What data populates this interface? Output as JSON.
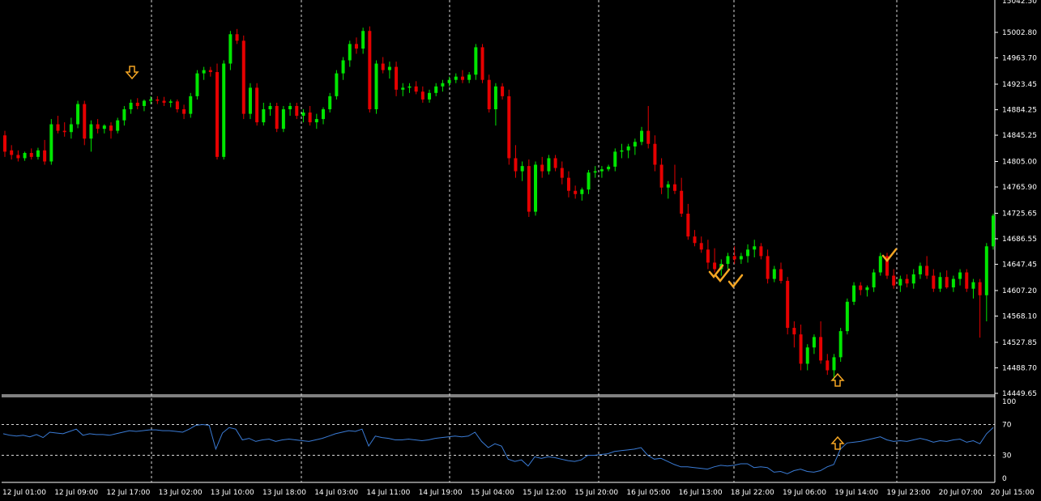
{
  "colors": {
    "background": "#000000",
    "bull": "#00e600",
    "bear": "#e60000",
    "grid": "#d8d8d8",
    "axis_text": "#ffffff",
    "indicator_line": "#3a7bd5",
    "marker": "#f5a623"
  },
  "price_axis": {
    "labels": [
      "15002.80",
      "14963.70",
      "14923.45",
      "14884.25",
      "14845.25",
      "14805.00",
      "14765.90",
      "14725.65",
      "14686.55",
      "14647.45",
      "14607.20",
      "14568.10",
      "14527.85",
      "14488.70",
      "14449.65"
    ],
    "top_label": "15042.50"
  },
  "indicator_axis": {
    "labels": [
      "100",
      "70",
      "30",
      "0"
    ]
  },
  "time_axis": {
    "labels": [
      "12 Jul 01:00",
      "12 Jul 09:00",
      "12 Jul 17:00",
      "13 Jul 02:00",
      "13 Jul 10:00",
      "13 Jul 18:00",
      "14 Jul 03:00",
      "14 Jul 11:00",
      "14 Jul 19:00",
      "15 Jul 04:00",
      "15 Jul 12:00",
      "15 Jul 20:00",
      "16 Jul 05:00",
      "16 Jul 13:00",
      "18 Jul 22:00",
      "19 Jul 06:00",
      "19 Jul 14:00",
      "19 Jul 23:00",
      "20 Jul 07:00",
      "20 Jul 15:00"
    ]
  },
  "markers": [
    {
      "type": "arrow-down",
      "near": "12 Jul 17:00"
    },
    {
      "type": "check",
      "near": "16 Jul 13:00"
    },
    {
      "type": "check",
      "near": "16 Jul 13:00"
    },
    {
      "type": "check",
      "near": "18 Jul 22:00"
    },
    {
      "type": "arrow-up",
      "near": "19 Jul 14:00"
    },
    {
      "type": "check",
      "near": "19 Jul 23:00"
    },
    {
      "type": "arrow-up-indicator",
      "near": "19 Jul 14:00"
    }
  ],
  "chart_data": {
    "type": "candlestick",
    "y_range": [
      14449.65,
      15042.5
    ],
    "indicator_range": [
      0,
      100
    ],
    "indicator_levels": [
      70,
      30
    ],
    "candles": [
      [
        14845,
        14852,
        14812,
        14820
      ],
      [
        14822,
        14830,
        14808,
        14815
      ],
      [
        14815,
        14822,
        14805,
        14810
      ],
      [
        14810,
        14820,
        14806,
        14818
      ],
      [
        14818,
        14825,
        14808,
        14812
      ],
      [
        14812,
        14826,
        14808,
        14822
      ],
      [
        14822,
        14838,
        14800,
        14805
      ],
      [
        14805,
        14870,
        14800,
        14862
      ],
      [
        14862,
        14875,
        14848,
        14852
      ],
      [
        14852,
        14865,
        14843,
        14850
      ],
      [
        14850,
        14872,
        14840,
        14862
      ],
      [
        14862,
        14898,
        14856,
        14893
      ],
      [
        14893,
        14898,
        14830,
        14840
      ],
      [
        14840,
        14868,
        14820,
        14862
      ],
      [
        14862,
        14870,
        14848,
        14855
      ],
      [
        14855,
        14862,
        14848,
        14860
      ],
      [
        14860,
        14865,
        14840,
        14852
      ],
      [
        14852,
        14872,
        14848,
        14868
      ],
      [
        14868,
        14890,
        14860,
        14885
      ],
      [
        14885,
        14900,
        14878,
        14895
      ],
      [
        14895,
        14902,
        14885,
        14890
      ],
      [
        14890,
        14900,
        14882,
        14898
      ],
      [
        14898,
        14905,
        14893,
        14900
      ],
      [
        14900,
        14905,
        14893,
        14898
      ],
      [
        14898,
        14904,
        14890,
        14895
      ],
      [
        14895,
        14900,
        14888,
        14897
      ],
      [
        14897,
        14900,
        14880,
        14885
      ],
      [
        14885,
        14892,
        14870,
        14878
      ],
      [
        14878,
        14910,
        14872,
        14905
      ],
      [
        14905,
        14945,
        14900,
        14940
      ],
      [
        14940,
        14950,
        14930,
        14945
      ],
      [
        14945,
        14950,
        14935,
        14942
      ],
      [
        14942,
        14955,
        14808,
        14812
      ],
      [
        14812,
        14960,
        14808,
        14955
      ],
      [
        14955,
        15005,
        14945,
        15000
      ],
      [
        15000,
        15008,
        14985,
        14990
      ],
      [
        14990,
        14998,
        14870,
        14878
      ],
      [
        14878,
        14925,
        14870,
        14918
      ],
      [
        14918,
        14925,
        14860,
        14865
      ],
      [
        14865,
        14895,
        14860,
        14885
      ],
      [
        14885,
        14895,
        14875,
        14890
      ],
      [
        14890,
        14895,
        14850,
        14855
      ],
      [
        14855,
        14890,
        14850,
        14885
      ],
      [
        14885,
        14895,
        14875,
        14890
      ],
      [
        14890,
        14895,
        14870,
        14875
      ],
      [
        14875,
        14885,
        14865,
        14880
      ],
      [
        14880,
        14890,
        14860,
        14865
      ],
      [
        14865,
        14878,
        14855,
        14870
      ],
      [
        14870,
        14888,
        14862,
        14885
      ],
      [
        14885,
        14910,
        14880,
        14905
      ],
      [
        14905,
        14945,
        14900,
        14940
      ],
      [
        14940,
        14965,
        14930,
        14960
      ],
      [
        14960,
        14990,
        14950,
        14985
      ],
      [
        14985,
        14995,
        14970,
        14978
      ],
      [
        14978,
        15010,
        14970,
        15005
      ],
      [
        15005,
        15012,
        14880,
        14885
      ],
      [
        14885,
        14960,
        14878,
        14955
      ],
      [
        14955,
        14965,
        14940,
        14945
      ],
      [
        14945,
        14958,
        14932,
        14950
      ],
      [
        14950,
        14958,
        14905,
        14915
      ],
      [
        14915,
        14925,
        14905,
        14918
      ],
      [
        14918,
        14925,
        14910,
        14920
      ],
      [
        14920,
        14928,
        14908,
        14912
      ],
      [
        14912,
        14920,
        14895,
        14900
      ],
      [
        14900,
        14915,
        14895,
        14910
      ],
      [
        14910,
        14925,
        14905,
        14920
      ],
      [
        14920,
        14930,
        14912,
        14925
      ],
      [
        14925,
        14935,
        14920,
        14930
      ],
      [
        14930,
        14940,
        14925,
        14935
      ],
      [
        14935,
        14945,
        14925,
        14930
      ],
      [
        14930,
        14942,
        14925,
        14938
      ],
      [
        14938,
        14985,
        14930,
        14980
      ],
      [
        14980,
        14985,
        14925,
        14930
      ],
      [
        14930,
        14938,
        14880,
        14885
      ],
      [
        14885,
        14925,
        14860,
        14920
      ],
      [
        14920,
        14925,
        14900,
        14905
      ],
      [
        14905,
        14915,
        14800,
        14810
      ],
      [
        14810,
        14830,
        14780,
        14790
      ],
      [
        14790,
        14805,
        14775,
        14798
      ],
      [
        14798,
        14808,
        14720,
        14728
      ],
      [
        14728,
        14805,
        14722,
        14800
      ],
      [
        14800,
        14812,
        14780,
        14790
      ],
      [
        14790,
        14815,
        14785,
        14810
      ],
      [
        14810,
        14815,
        14790,
        14795
      ],
      [
        14795,
        14805,
        14770,
        14780
      ],
      [
        14780,
        14790,
        14750,
        14760
      ],
      [
        14760,
        14768,
        14748,
        14755
      ],
      [
        14755,
        14765,
        14745,
        14762
      ],
      [
        14762,
        14792,
        14755,
        14788
      ],
      [
        14788,
        14798,
        14780,
        14790
      ],
      [
        14790,
        14798,
        14780,
        14793
      ],
      [
        14793,
        14800,
        14790,
        14797
      ],
      [
        14797,
        14825,
        14790,
        14820
      ],
      [
        14820,
        14832,
        14810,
        14822
      ],
      [
        14822,
        14832,
        14810,
        14828
      ],
      [
        14828,
        14840,
        14815,
        14835
      ],
      [
        14835,
        14858,
        14830,
        14852
      ],
      [
        14852,
        14890,
        14825,
        14832
      ],
      [
        14832,
        14845,
        14790,
        14800
      ],
      [
        14800,
        14810,
        14755,
        14765
      ],
      [
        14765,
        14775,
        14748,
        14770
      ],
      [
        14770,
        14800,
        14755,
        14760
      ],
      [
        14760,
        14780,
        14720,
        14725
      ],
      [
        14725,
        14740,
        14685,
        14690
      ],
      [
        14690,
        14700,
        14675,
        14680
      ],
      [
        14680,
        14690,
        14665,
        14670
      ],
      [
        14670,
        14685,
        14640,
        14650
      ],
      [
        14650,
        14672,
        14635,
        14640
      ],
      [
        14640,
        14655,
        14630,
        14648
      ],
      [
        14648,
        14665,
        14640,
        14660
      ],
      [
        14660,
        14675,
        14648,
        14655
      ],
      [
        14655,
        14665,
        14648,
        14660
      ],
      [
        14660,
        14678,
        14650,
        14670
      ],
      [
        14670,
        14685,
        14658,
        14675
      ],
      [
        14675,
        14680,
        14655,
        14660
      ],
      [
        14660,
        14670,
        14618,
        14625
      ],
      [
        14625,
        14645,
        14620,
        14640
      ],
      [
        14640,
        14650,
        14618,
        14622
      ],
      [
        14622,
        14628,
        14540,
        14550
      ],
      [
        14550,
        14560,
        14520,
        14540
      ],
      [
        14540,
        14555,
        14485,
        14495
      ],
      [
        14495,
        14525,
        14485,
        14520
      ],
      [
        14520,
        14540,
        14510,
        14536
      ],
      [
        14536,
        14560,
        14495,
        14500
      ],
      [
        14500,
        14510,
        14478,
        14485
      ],
      [
        14485,
        14510,
        14470,
        14505
      ],
      [
        14505,
        14550,
        14498,
        14545
      ],
      [
        14545,
        14595,
        14540,
        14590
      ],
      [
        14590,
        14620,
        14585,
        14615
      ],
      [
        14615,
        14620,
        14600,
        14608
      ],
      [
        14608,
        14615,
        14598,
        14612
      ],
      [
        14612,
        14640,
        14605,
        14635
      ],
      [
        14635,
        14665,
        14630,
        14660
      ],
      [
        14660,
        14665,
        14625,
        14630
      ],
      [
        14630,
        14640,
        14610,
        14615
      ],
      [
        14615,
        14630,
        14605,
        14625
      ],
      [
        14625,
        14632,
        14612,
        14618
      ],
      [
        14618,
        14640,
        14610,
        14632
      ],
      [
        14632,
        14650,
        14625,
        14645
      ],
      [
        14645,
        14660,
        14625,
        14630
      ],
      [
        14630,
        14640,
        14605,
        14610
      ],
      [
        14610,
        14635,
        14605,
        14628
      ],
      [
        14628,
        14638,
        14610,
        14612
      ],
      [
        14612,
        14630,
        14605,
        14625
      ],
      [
        14625,
        14640,
        14615,
        14635
      ],
      [
        14635,
        14640,
        14605,
        14610
      ],
      [
        14610,
        14625,
        14595,
        14620
      ],
      [
        14620,
        14625,
        14535,
        14600
      ],
      [
        14600,
        14680,
        14560,
        14675
      ],
      [
        14675,
        14725,
        14670,
        14722
      ]
    ],
    "indicator": [
      58,
      56,
      55,
      56,
      54,
      57,
      53,
      60,
      59,
      58,
      61,
      64,
      56,
      58,
      57,
      57,
      56,
      58,
      60,
      62,
      61,
      62,
      63,
      63,
      62,
      62,
      61,
      60,
      64,
      69,
      70,
      69,
      38,
      59,
      66,
      64,
      50,
      52,
      48,
      50,
      51,
      48,
      50,
      51,
      50,
      49,
      48,
      50,
      52,
      55,
      58,
      60,
      62,
      61,
      64,
      42,
      55,
      53,
      52,
      50,
      50,
      51,
      50,
      49,
      50,
      52,
      53,
      54,
      55,
      54,
      55,
      60,
      48,
      40,
      45,
      42,
      25,
      22,
      24,
      16,
      28,
      26,
      28,
      27,
      25,
      23,
      22,
      24,
      30,
      30,
      31,
      32,
      35,
      36,
      37,
      38,
      40,
      30,
      25,
      26,
      22,
      18,
      15,
      15,
      14,
      13,
      12,
      15,
      17,
      16,
      17,
      19,
      19,
      14,
      15,
      14,
      8,
      9,
      6,
      10,
      12,
      9,
      8,
      10,
      15,
      18,
      38,
      46,
      47,
      48,
      50,
      52,
      54,
      50,
      48,
      49,
      48,
      50,
      52,
      50,
      47,
      49,
      48,
      50,
      51,
      47,
      49,
      45,
      58,
      66
    ]
  }
}
